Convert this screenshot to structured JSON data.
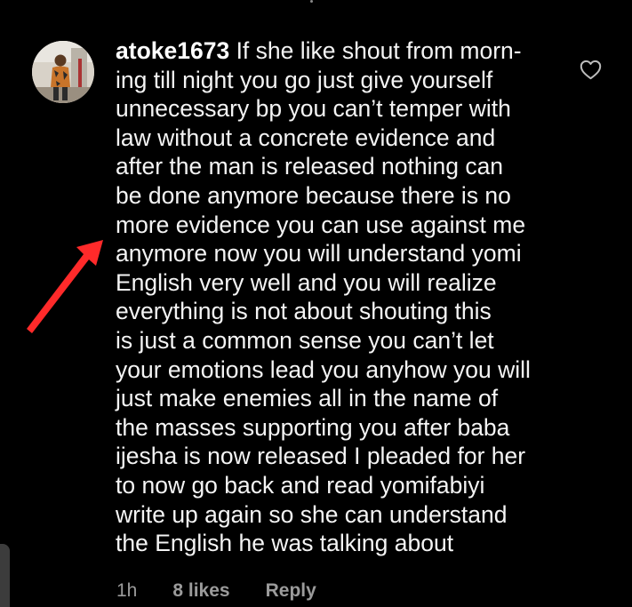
{
  "comment": {
    "username": "atoke1673",
    "lines": [
      "If she like shout from morn-",
      "ing till night you go just give yourself",
      "unnecessary bp you can’t temper with",
      "law without a concrete evidence and",
      "after the man is released nothing can",
      "be done anymore because there is no",
      "more evidence you can use against me",
      "anymore now you will understand yomi",
      "English very well and you will realize",
      "everything is not about shouting this",
      "is just a common sense you can’t let",
      "your emotions lead you anyhow you will",
      "just make enemies all in the name of",
      "the masses supporting you after baba",
      "ijesha is now released I pleaded for her",
      "to now go back and read yomifabiyi",
      "write up again so she can understand",
      "the English he was talking about"
    ],
    "time": "1h",
    "likes": "8 likes",
    "reply_label": "Reply"
  },
  "icons": {
    "like": "heart-outline-icon",
    "annotation": "red-arrow-icon"
  },
  "colors": {
    "background": "#000000",
    "text": "#f4f4f4",
    "meta_text": "#9b9b9b",
    "arrow": "#ff2a2a"
  }
}
